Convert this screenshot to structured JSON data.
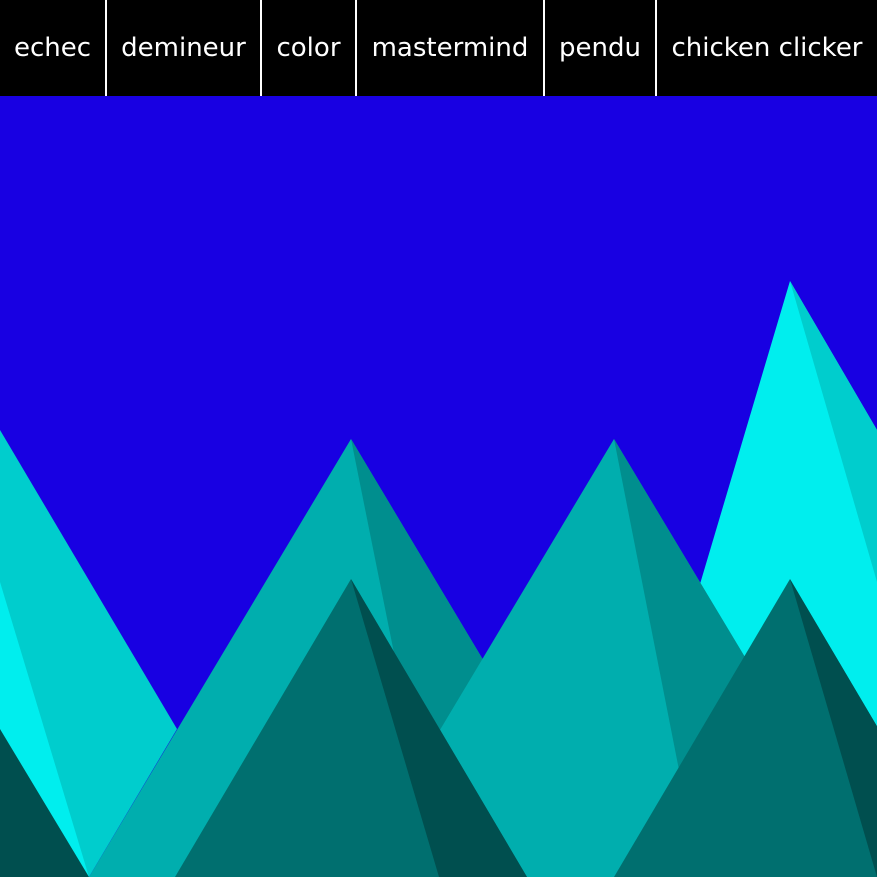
{
  "nav": {
    "items": [
      {
        "label": "echec"
      },
      {
        "label": "demineur"
      },
      {
        "label": "color"
      },
      {
        "label": "mastermind"
      },
      {
        "label": "pendu"
      },
      {
        "label": "chicken clicker"
      }
    ]
  },
  "colors": {
    "sky": "#1800e2",
    "nav_background": "#000000",
    "nav_text": "#ffffff",
    "mountain_far_light": "#00eeee",
    "mountain_far_shade": "#00cdcd",
    "mountain_mid_light": "#00aeae",
    "mountain_mid_shade": "#008e8e",
    "mountain_near_light": "#006f6f",
    "mountain_near_shade": "#004f4f"
  }
}
